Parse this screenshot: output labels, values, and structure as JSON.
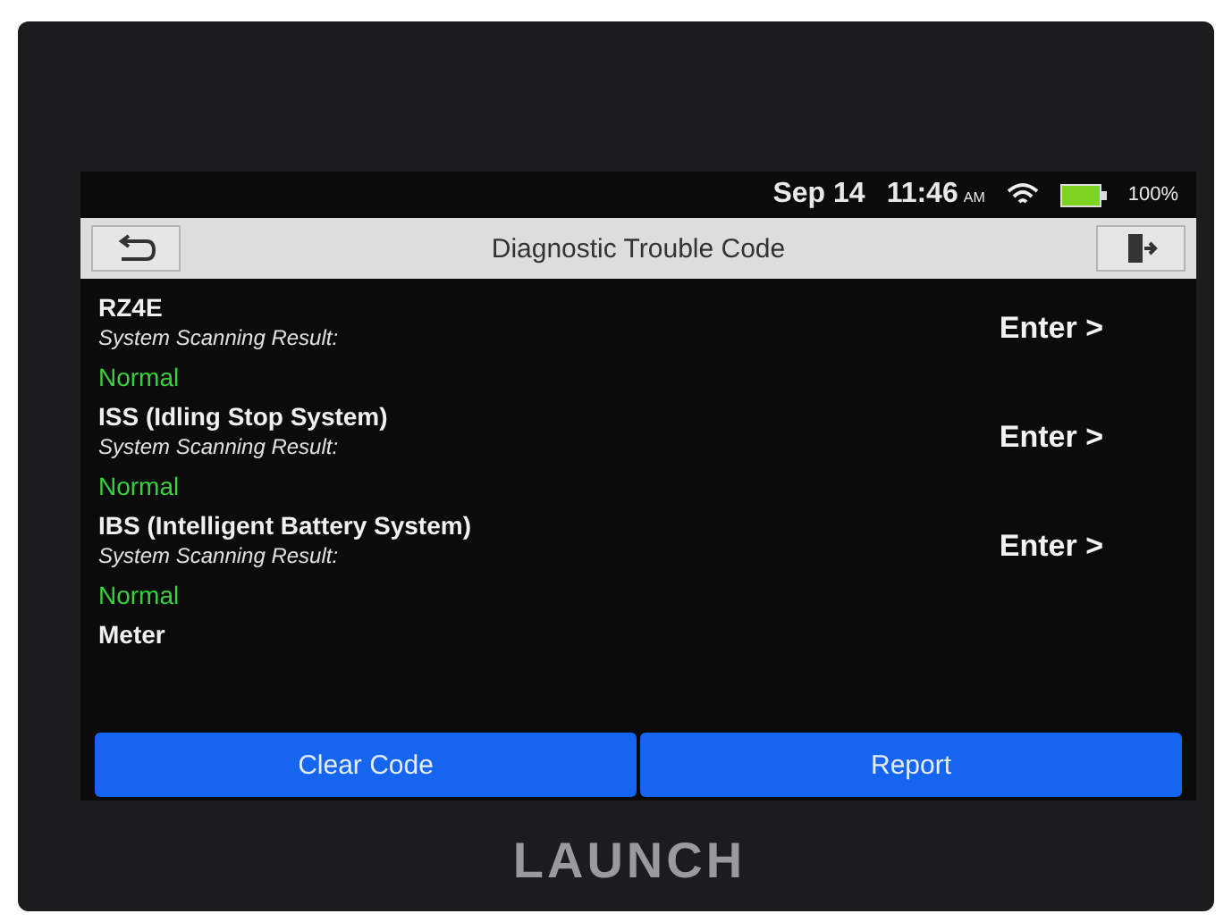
{
  "status_bar": {
    "date": "Sep 14",
    "time": "11:46",
    "meridiem": "AM",
    "battery": "100%"
  },
  "header": {
    "title": "Diagnostic Trouble Code"
  },
  "systems": [
    {
      "name": "RZ4E",
      "label": "System Scanning Result:",
      "result": "Normal",
      "action": "Enter >"
    },
    {
      "name": "ISS (Idling Stop System)",
      "label": "System Scanning Result:",
      "result": "Normal",
      "action": "Enter >"
    },
    {
      "name": "IBS (Intelligent Battery System)",
      "label": "System Scanning Result:",
      "result": "Normal",
      "action": "Enter >"
    },
    {
      "name": "Meter"
    }
  ],
  "buttons": [
    "Clear Code",
    "Report"
  ],
  "device": {
    "brand": "LAUNCH"
  }
}
